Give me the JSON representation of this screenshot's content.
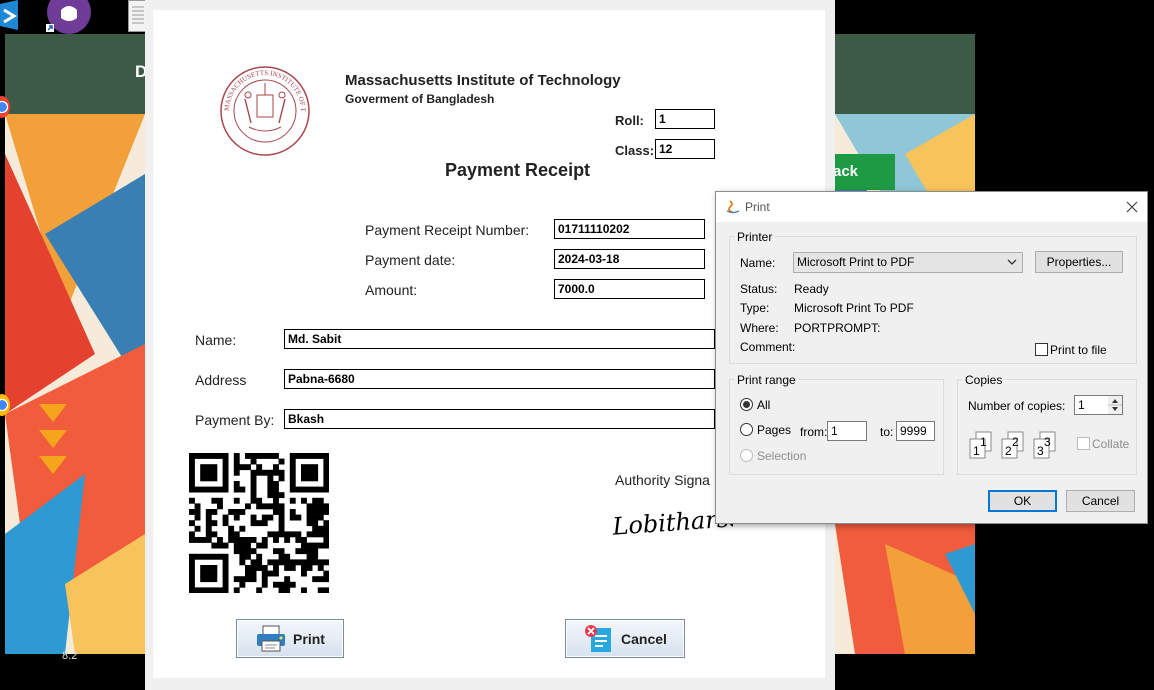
{
  "desktop": {
    "bottom_text": "8.2"
  },
  "background_app": {
    "title_partial": "D",
    "button_partial": "ack"
  },
  "receipt": {
    "institution": "Massachusetts Institute of Technology",
    "subtitle": "Goverment of Bangladesh",
    "roll_label": "Roll:",
    "roll_value": "1",
    "class_label": "Class:",
    "class_value": "12",
    "title": "Payment Receipt",
    "receipt_number_label": "Payment Receipt Number:",
    "receipt_number_value": "01711110202",
    "date_label": "Payment date:",
    "date_value": "2024-03-18",
    "amount_label": "Amount:",
    "amount_value": "7000.0",
    "name_label": "Name:",
    "name_value": "Md. Sabit",
    "address_label": "Address",
    "address_value": "Pabna-6680",
    "payment_by_label": "Payment By:",
    "payment_by_value": "Bkash",
    "authority_label": "Authority Signa",
    "print_button": "Print",
    "cancel_button": "Cancel",
    "seal_text": "MASSACHUSETTS INSTITUTE OF TECHNOLOGY",
    "signature_text": "Lobitharsan"
  },
  "print_dialog": {
    "title": "Print",
    "printer_group": "Printer",
    "name_label": "Name:",
    "printer_name": "Microsoft Print to PDF",
    "properties_button": "Properties...",
    "status_label": "Status:",
    "status_value": "Ready",
    "type_label": "Type:",
    "type_value": "Microsoft Print To PDF",
    "where_label": "Where:",
    "where_value": "PORTPROMPT:",
    "comment_label": "Comment:",
    "print_to_file_label": "Print to file",
    "range_group": "Print range",
    "all_label": "All",
    "pages_label": "Pages",
    "from_label": "from:",
    "from_value": "1",
    "to_label": "to:",
    "to_value": "9999",
    "selection_label": "Selection",
    "copies_group": "Copies",
    "copies_label": "Number of copies:",
    "copies_value": "1",
    "collate_label": "Collate",
    "ok_button": "OK",
    "cancel_button": "Cancel"
  },
  "colors": {
    "header_green": "#3d5a46",
    "button_green": "#1f9a44",
    "seal_red": "#a8464e",
    "dialog_bg": "#f0f0f0",
    "focus_blue": "#0078d7"
  },
  "icons": [
    "vscode-icon",
    "github-icon",
    "document-icon",
    "chrome-icon",
    "printer-icon",
    "cancel-receipt-icon",
    "java-icon",
    "close-icon",
    "dropdown-arrow-icon",
    "spinner-icon",
    "collate-pages-icon"
  ]
}
